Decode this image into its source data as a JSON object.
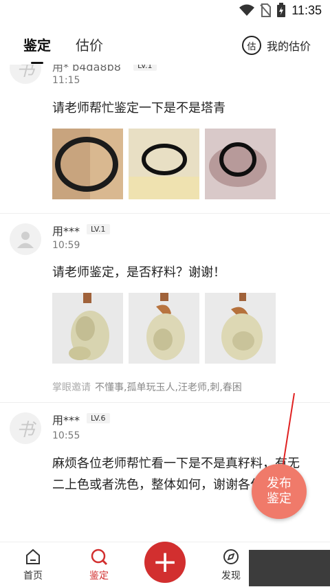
{
  "status": {
    "time": "11:35"
  },
  "header": {
    "tabs": [
      {
        "label": "鉴定",
        "active": true
      },
      {
        "label": "估价",
        "active": false
      }
    ],
    "my_eval_icon_char": "估",
    "my_eval_label": "我的估价"
  },
  "posts": [
    {
      "avatar_glyph": "书",
      "username": "用* b4da8b8",
      "level": "LV.1",
      "time": "11:15",
      "text": "请老师帮忙鉴定一下是不是塔青",
      "images": [
        "bracelet-on-wrist",
        "bracelet-on-table",
        "bracelet-in-hand"
      ]
    },
    {
      "avatar_glyph": "person",
      "username": "用***",
      "level": "LV.1",
      "time": "10:59",
      "text": "请老师鉴定，是否籽料？谢谢！",
      "images": [
        "jade-pendant-1",
        "jade-pendant-2",
        "jade-pendant-3"
      ],
      "invite_label": "掌眼邀请",
      "invite_names": "不懂事,孤单玩玉人,汪老师,刺,春困"
    },
    {
      "avatar_glyph": "书",
      "username": "用***",
      "level": "LV.6",
      "time": "10:55",
      "text": "麻烦各位老师帮忙看一下是不是真籽料，有无二上色或者洗色，整体如何，谢谢各位老师了"
    }
  ],
  "fab": {
    "line1": "发布",
    "line2": "鉴定"
  },
  "bottom_nav": {
    "items": [
      {
        "label": "首页",
        "icon": "home-icon"
      },
      {
        "label": "鉴定",
        "icon": "appraise-icon",
        "active": true
      },
      {
        "label": "+",
        "icon": "plus-icon"
      },
      {
        "label": "发现",
        "icon": "discover-icon"
      }
    ]
  },
  "colors": {
    "accent": "#d22f2f",
    "fab": "#f07a6a"
  }
}
